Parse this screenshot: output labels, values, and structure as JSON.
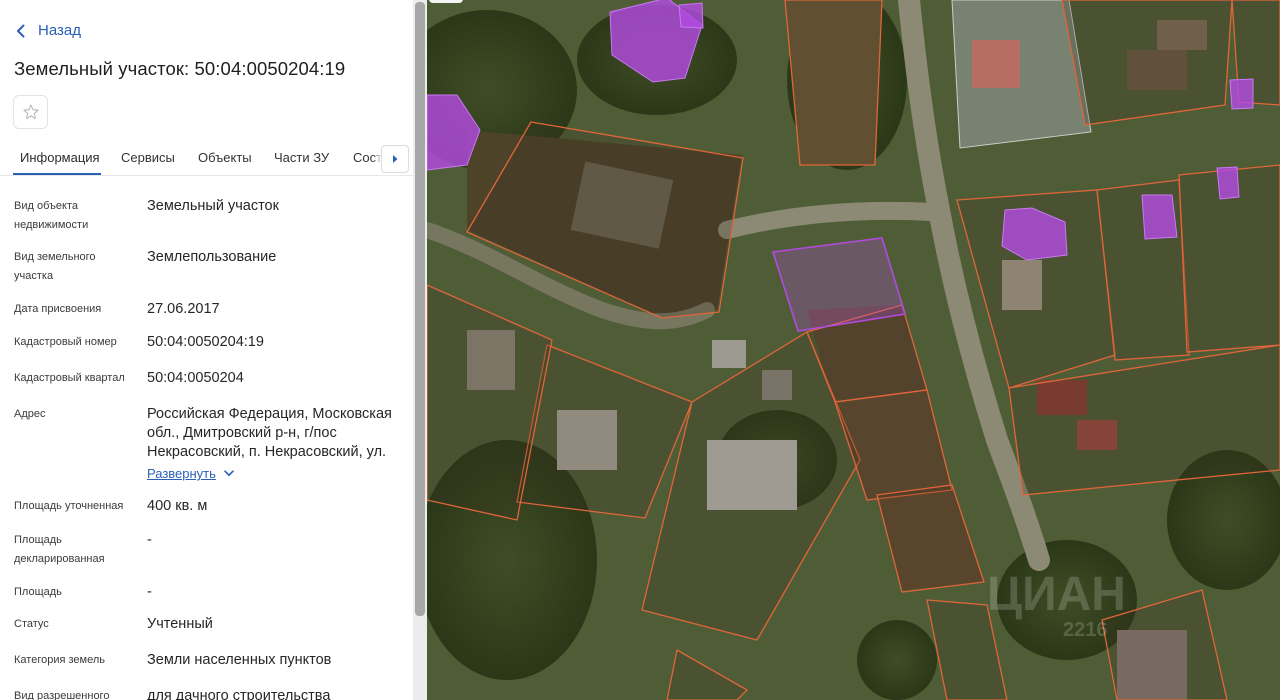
{
  "nav": {
    "back_label": "Назад"
  },
  "title": "Земельный участок: 50:04:0050204:19",
  "favorite_icon": "star-icon",
  "tabs": [
    {
      "label": "Информация",
      "active": true
    },
    {
      "label": "Сервисы"
    },
    {
      "label": "Объекты"
    },
    {
      "label": "Части ЗУ"
    },
    {
      "label": "Состав"
    }
  ],
  "tab_scroll_icon": "chevron-right-icon",
  "details": [
    {
      "label": "Вид объекта недвижимости",
      "value": "Земельный участок"
    },
    {
      "label": "Вид земельного участка",
      "value": "Землепользование"
    },
    {
      "label": "Дата присвоения",
      "value": "27.06.2017"
    },
    {
      "label": "Кадастровый номер",
      "value": "50:04:0050204:19"
    },
    {
      "label": "Кадастровый квартал",
      "value": "50:04:0050204"
    },
    {
      "label": "Адрес",
      "value": "Российская Федерация, Московская обл., Дмитровский р-н, г/пос Некрасовский, п. Некрасовский, ул."
    },
    {
      "label": "Площадь уточненная",
      "value": "400 кв. м"
    },
    {
      "label": "Площадь декларированная",
      "value": "-"
    },
    {
      "label": "Площадь",
      "value": "-"
    },
    {
      "label": "Статус",
      "value": "Учтенный"
    },
    {
      "label": "Категория земель",
      "value": "Земли населенных пунктов"
    },
    {
      "label": "Вид разрешенного",
      "value": "для дачного строительства"
    }
  ],
  "address_expand_label": "Развернуть",
  "map": {
    "watermark_text": "ЦИАН",
    "watermark_code": "2216",
    "colors": {
      "parcel_border": "#e0653a",
      "selected_parcel": "#b44ae0",
      "building_overlay": "#b24be0",
      "accent": "#2a5fb8"
    }
  }
}
